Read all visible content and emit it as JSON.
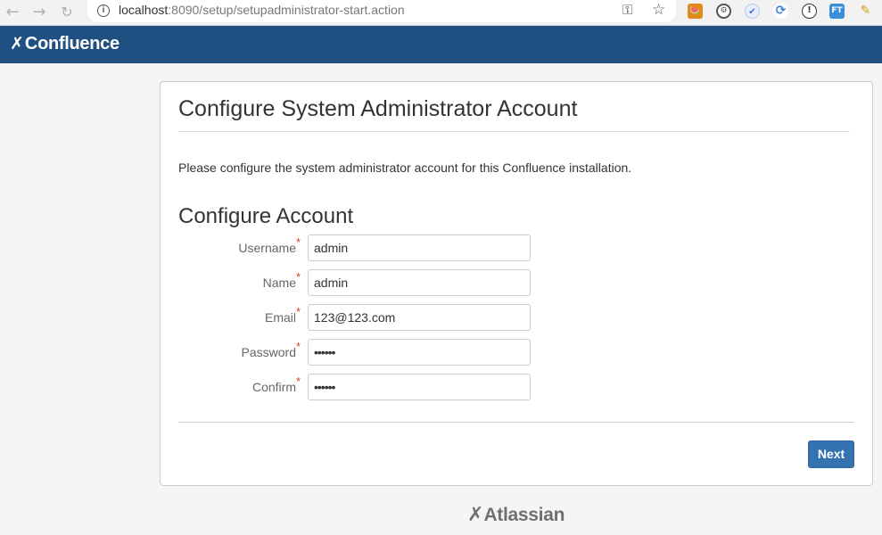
{
  "browser": {
    "url_host": "localhost",
    "url_rest": ":8090/setup/setupadministrator-start.action",
    "icons": {
      "back": "arrow-left-icon",
      "forward": "arrow-right-icon",
      "reload": "reload-icon",
      "info": "info-icon",
      "key": "key-icon",
      "star": "star-icon"
    },
    "extensions": [
      {
        "name": "extension-1-icon",
        "glyph": "🍉"
      },
      {
        "name": "extension-2-icon",
        "glyph": "⚙"
      },
      {
        "name": "extension-3-icon",
        "glyph": "✔"
      },
      {
        "name": "extension-4-icon",
        "glyph": "⟳"
      },
      {
        "name": "extension-5-icon",
        "glyph": "!"
      },
      {
        "name": "extension-6-icon",
        "glyph": "FT"
      },
      {
        "name": "extension-7-icon",
        "glyph": "✎"
      }
    ]
  },
  "header": {
    "logo_text": "Confluence",
    "logo_icon": "confluence-icon",
    "background": "#205081"
  },
  "main": {
    "title": "Configure System Administrator Account",
    "intro": "Please configure the system administrator account for this Confluence installation.",
    "section_title": "Configure Account",
    "required_marker": "*",
    "fields": [
      {
        "label": "Username",
        "value": "admin",
        "type": "text"
      },
      {
        "label": "Name",
        "value": "admin",
        "type": "text"
      },
      {
        "label": "Email",
        "value": "123@123.com",
        "type": "text"
      },
      {
        "label": "Password",
        "value": "••••••",
        "type": "password"
      },
      {
        "label": "Confirm",
        "value": "••••••",
        "type": "password"
      }
    ],
    "next_label": "Next",
    "accent": "#3572b0",
    "required_color": "#d04437"
  },
  "footer": {
    "logo_text": "Atlassian",
    "logo_icon": "atlassian-icon"
  }
}
